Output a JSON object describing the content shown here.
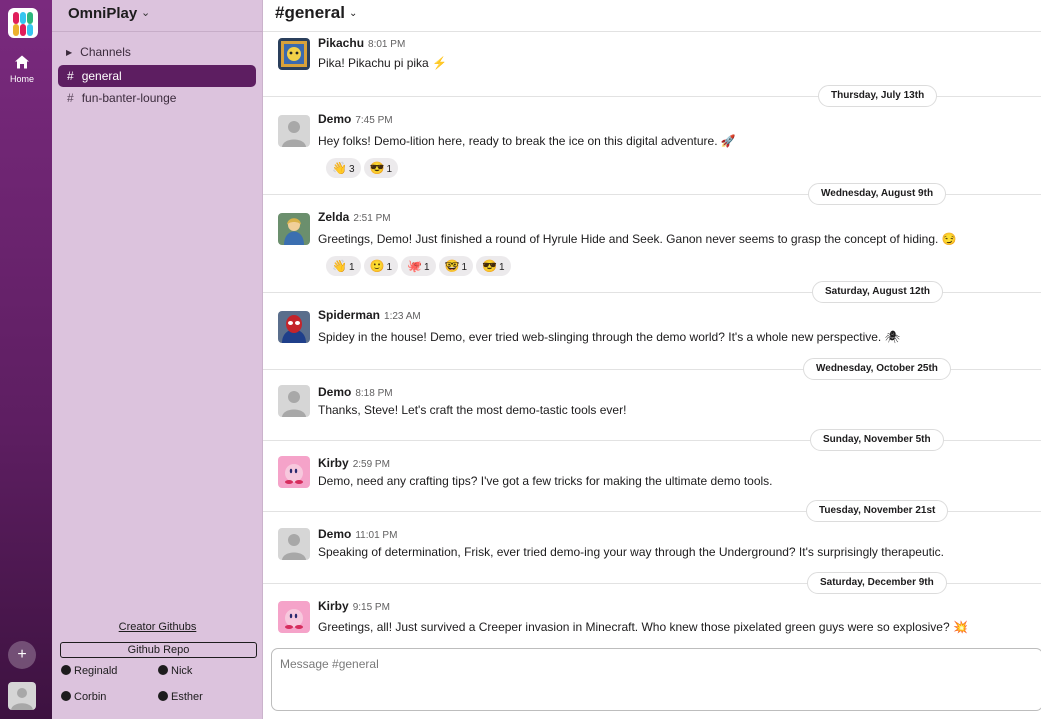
{
  "rail": {
    "home_label": "Home",
    "add_label": "+"
  },
  "workspace": {
    "name": "OmniPlay"
  },
  "sidebar": {
    "channels_header": "Channels",
    "channels": [
      {
        "name": "general",
        "active": true
      },
      {
        "name": "fun-banter-lounge",
        "active": false
      }
    ],
    "creator_label": "Creator Githubs",
    "repo_label": "Github Repo",
    "github_users": [
      "Reginald",
      "Nick",
      "Corbin",
      "Esther"
    ]
  },
  "header": {
    "hash": "#",
    "channel": "general"
  },
  "messages": [
    {
      "user": "Pikachu",
      "time": "8:01 PM",
      "text": "Pika! Pikachu pi pika ⚡"
    },
    {
      "user": "Demo",
      "time": "7:45 PM",
      "text": "Hey folks! Demo-lition here, ready to break the ice on this digital adventure. 🚀",
      "reactions": [
        {
          "emoji": "👋",
          "count": "3"
        },
        {
          "emoji": "😎",
          "count": "1"
        }
      ]
    },
    {
      "user": "Zelda",
      "time": "2:51 PM",
      "text": "Greetings, Demo! Just finished a round of Hyrule Hide and Seek. Ganon never seems to grasp the concept of hiding. 😏",
      "reactions": [
        {
          "emoji": "👋",
          "count": "1"
        },
        {
          "emoji": "🙂",
          "count": "1"
        },
        {
          "emoji": "🐙",
          "count": "1"
        },
        {
          "emoji": "🤓",
          "count": "1"
        },
        {
          "emoji": "😎",
          "count": "1"
        }
      ]
    },
    {
      "user": "Spiderman",
      "time": "1:23 AM",
      "text": "Spidey in the house! Demo, ever tried web-slinging through the demo world? It's a whole new perspective. 🕷"
    },
    {
      "user": "Demo",
      "time": "8:18 PM",
      "text": "Thanks, Steve! Let's craft the most demo-tastic tools ever!"
    },
    {
      "user": "Kirby",
      "time": "2:59 PM",
      "text": "Demo, need any crafting tips? I've got a few tricks for making the ultimate demo tools."
    },
    {
      "user": "Demo",
      "time": "11:01 PM",
      "text": "Speaking of determination, Frisk, ever tried demo-ing your way through the Underground? It's surprisingly therapeutic."
    },
    {
      "user": "Kirby",
      "time": "9:15 PM",
      "text": "Greetings, all! Just survived a Creeper invasion in Minecraft. Who knew those pixelated green guys were so explosive? 💥"
    }
  ],
  "dates": [
    "Thursday, July 13th",
    "Wednesday, August 9th",
    "Saturday, August 12th",
    "Wednesday, October 25th",
    "Sunday, November 5th",
    "Tuesday, November 21st",
    "Saturday, December 9th"
  ],
  "composer": {
    "placeholder": "Message #general"
  },
  "colors": {
    "rail": "#5d1e61",
    "sidebar": "#dcc3dd",
    "active_channel": "#5d1e61"
  }
}
